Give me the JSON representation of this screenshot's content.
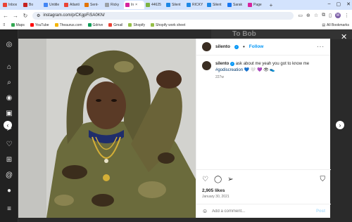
{
  "browser": {
    "tabs": [
      {
        "label": "Inbox",
        "color": "#ea4335"
      },
      {
        "label": "Bo",
        "color": "#c5221f"
      },
      {
        "label": "Untitle",
        "color": "#4285f4"
      },
      {
        "label": "Atlanti",
        "color": "#ea4335"
      },
      {
        "label": "Sent-",
        "color": "#e37400"
      },
      {
        "label": "Ricky",
        "color": "#9aa0a6"
      },
      {
        "label": "In",
        "color": "#d6249f",
        "active": true
      },
      {
        "label": "44625",
        "color": "#7cb342"
      },
      {
        "label": "Silent",
        "color": "#1e88e5"
      },
      {
        "label": "RICKY",
        "color": "#1e88e5"
      },
      {
        "label": "Silent",
        "color": "#1e88e5"
      },
      {
        "label": "Sarak",
        "color": "#1877f2"
      },
      {
        "label": "Page",
        "color": "#d6249f"
      }
    ],
    "new_tab": "+",
    "url": "instagram.com/p/CKgpFiSA0KN/",
    "profile_initial": "M",
    "bookmarks": [
      {
        "label": "Maps",
        "color": "#34a853"
      },
      {
        "label": "YouTube",
        "color": "#ff0000"
      },
      {
        "label": "Theaurus.com",
        "color": "#f4b400"
      },
      {
        "label": "Gdrive",
        "color": "#0f9d58"
      },
      {
        "label": "Gmail",
        "color": "#ea4335"
      },
      {
        "label": "Shopify",
        "color": "#95bf47"
      },
      {
        "label": "Shopify work sheet",
        "color": "#95bf47"
      }
    ],
    "all_bookmarks": "All Bookmarks"
  },
  "background": {
    "strip_text": "To Bob"
  },
  "post": {
    "username": "silento",
    "verified_mark": "✓",
    "dot": "•",
    "follow_label": "Follow",
    "more_label": "···",
    "caption_text": "ask about me yeah you got to know me",
    "caption_tags": "#godiscreation",
    "caption_emojis": "💙 🤍 💜 👁 👟",
    "caption_age": "227w",
    "likes": "2,905 likes",
    "date": "January 30, 2021",
    "comment_placeholder": "Add a comment...",
    "post_label": "Post"
  },
  "colors": {
    "accent": "#0095f6",
    "tab_strip": "#d3e3fd"
  }
}
